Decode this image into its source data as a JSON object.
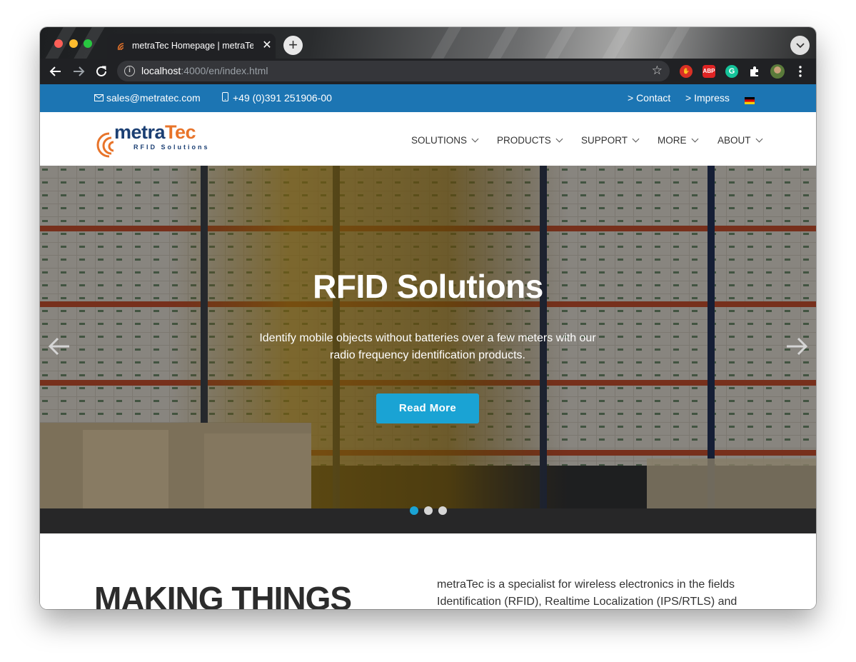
{
  "browser": {
    "tab_title": "metraTec Homepage | metraTec",
    "tab_close": "✕",
    "new_tab": "+",
    "url_host": "localhost",
    "url_rest": ":4000/en/index.html",
    "extensions": [
      "stop-extension-icon",
      "adblock-plus-icon",
      "grammarly-icon",
      "puzzle-extensions-icon",
      "profile-avatar"
    ],
    "abp_label": "ABP"
  },
  "topbar": {
    "email": "sales@metratec.com",
    "phone": "+49 (0)391 251906-00",
    "contact": "> Contact",
    "impress": "> Impress",
    "language_flag": "german-flag-icon"
  },
  "header": {
    "logo_main_part1": "metra",
    "logo_main_part2": "Tec",
    "logo_sub": "RFID Solutions",
    "nav": [
      {
        "label": "SOLUTIONS"
      },
      {
        "label": "PRODUCTS"
      },
      {
        "label": "SUPPORT"
      },
      {
        "label": "MORE"
      },
      {
        "label": "ABOUT"
      }
    ]
  },
  "hero": {
    "title": "RFID Solutions",
    "text": "Identify mobile objects without batteries over a few meters with our radio frequency identification products.",
    "button": "Read More",
    "slides": 3,
    "active_slide": 1
  },
  "section": {
    "heading": "MAKING THINGS",
    "text": "metraTec is a specialist for wireless electronics in the fields Identification (RFID), Realtime Localization (IPS/RTLS) and"
  },
  "colors": {
    "topbar": "#1c75b3",
    "accent": "#1aa3d4",
    "logo_blue": "#1b3f73",
    "logo_orange": "#e8742a"
  }
}
